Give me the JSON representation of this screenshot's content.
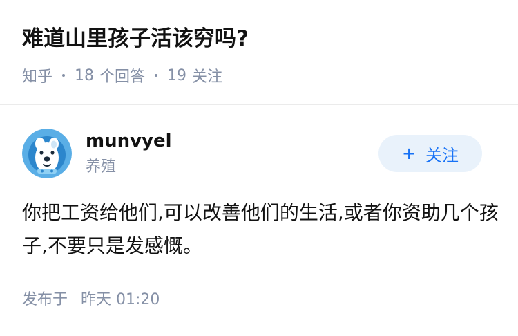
{
  "question": {
    "title": "难道山里孩子活该穷吗?",
    "source": "知乎",
    "answer_count": "18",
    "answer_label": "个回答",
    "follower_count": "19",
    "follower_label": "关注"
  },
  "answer": {
    "author": {
      "name": "munvyel",
      "bio": "养殖",
      "avatar_icon": "cartoon-dog-avatar"
    },
    "follow_button": {
      "icon": "+",
      "label": "关注"
    },
    "content": "你把工资给他们,可以改善他们的生活,或者你资助几个孩子,不要只是发感慨。",
    "published_label": "发布于",
    "published_time": "昨天 01:20"
  },
  "colors": {
    "text_primary": "#121212",
    "text_secondary": "#8590a6",
    "accent": "#1772f6",
    "follow_bg": "#e9f2fb",
    "divider": "#ebebeb"
  }
}
